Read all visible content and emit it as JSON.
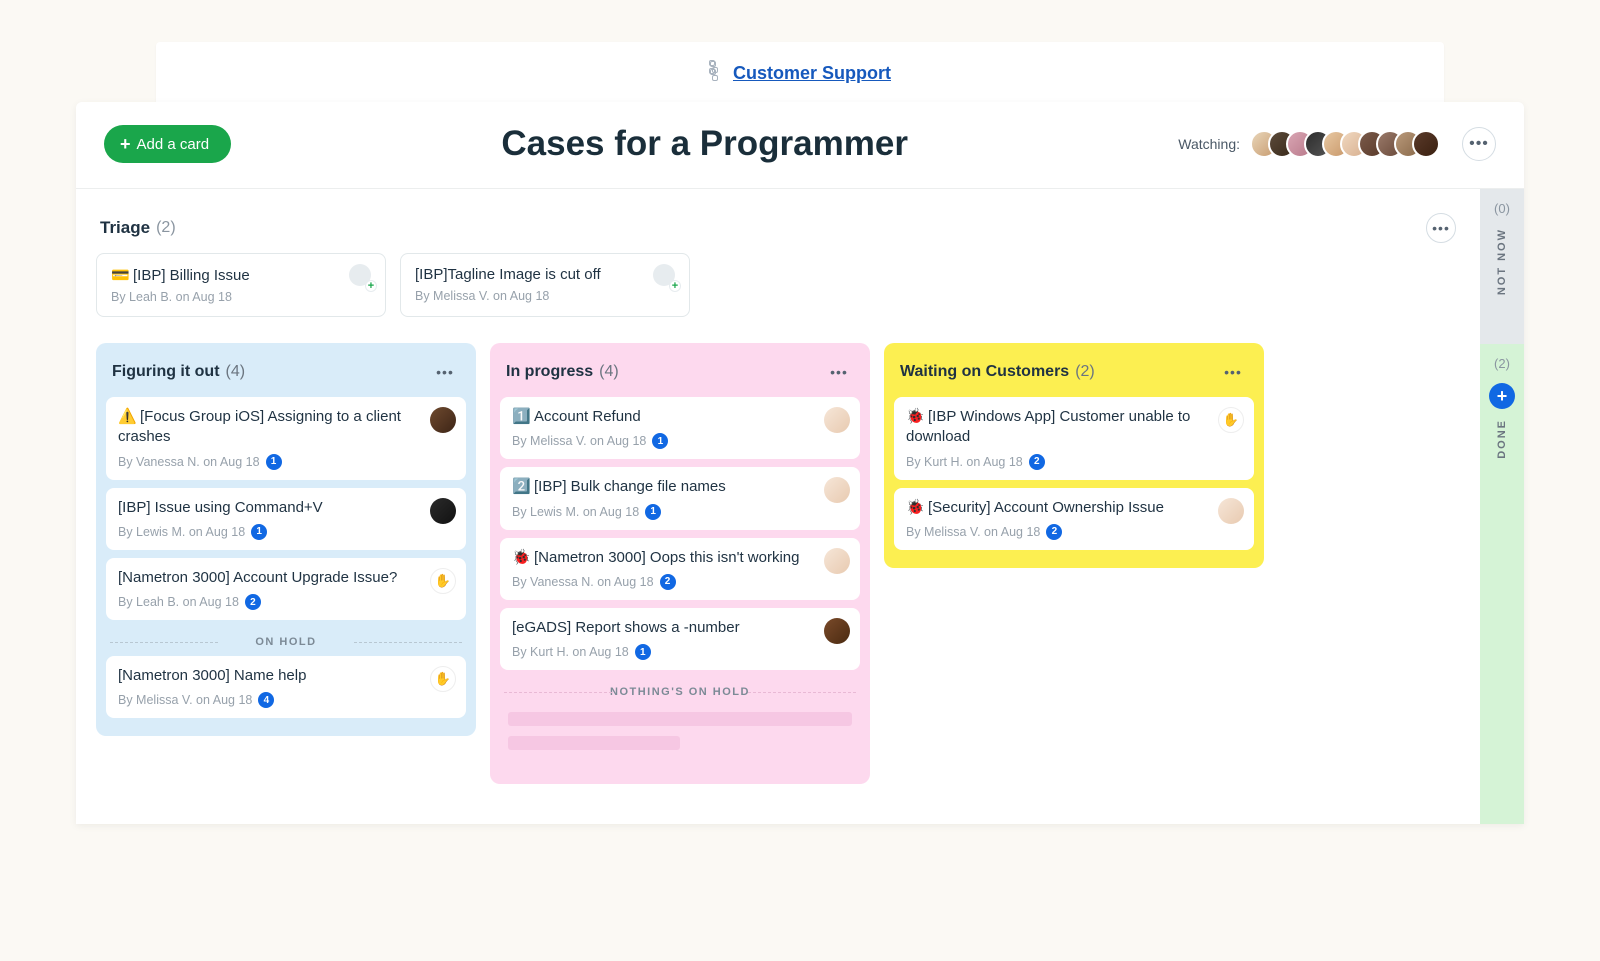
{
  "breadcrumb": {
    "label": "Customer Support"
  },
  "header": {
    "add_card_label": "Add a card",
    "title": "Cases for a Programmer",
    "watching_label": "Watching:"
  },
  "triage": {
    "title": "Triage",
    "count": "(2)",
    "cards": [
      {
        "icon": "💳",
        "title": "[IBP] Billing Issue",
        "by": "By Leah B. on Aug 18"
      },
      {
        "icon": "",
        "title": "[IBP]Tagline Image is cut off",
        "by": "By Melissa V. on Aug 18"
      }
    ]
  },
  "rails": {
    "not_now": {
      "count": "(0)",
      "label": "NOT NOW"
    },
    "done": {
      "count": "(2)",
      "label": "DONE"
    }
  },
  "columns": [
    {
      "color": "blue",
      "title": "Figuring it out",
      "count": "(4)",
      "cards": [
        {
          "icon": "⚠️",
          "title": "[Focus Group iOS] Assigning to a client crashes",
          "by": "By Vanessa N. on Aug 18",
          "badge": "1",
          "avatar": "v"
        },
        {
          "icon": "",
          "title": "[IBP] Issue using Command+V",
          "by": "By Lewis M. on Aug 18",
          "badge": "1",
          "avatar": "l"
        },
        {
          "icon": "",
          "title": "[Nametron 3000] Account Upgrade Issue?",
          "by": "By Leah B. on Aug 18",
          "badge": "2",
          "avatar": "badgeimg"
        }
      ],
      "on_hold_label": "ON HOLD",
      "hold_cards": [
        {
          "icon": "",
          "title": "[Nametron 3000] Name help",
          "by": "By Melissa V. on Aug 18",
          "badge": "4",
          "avatar": "badgeimg"
        }
      ]
    },
    {
      "color": "pink",
      "title": "In progress",
      "count": "(4)",
      "cards": [
        {
          "icon": "1️⃣",
          "title": "Account Refund",
          "by": "By Melissa V. on Aug 18",
          "badge": "1",
          "avatar": "p"
        },
        {
          "icon": "2️⃣",
          "title": "[IBP] Bulk change file names",
          "by": "By Lewis M. on Aug 18",
          "badge": "1",
          "avatar": "p"
        },
        {
          "icon": "🐞",
          "title": "[Nametron 3000] Oops this isn't working",
          "by": "By Vanessa N. on Aug 18",
          "badge": "2",
          "avatar": "p"
        },
        {
          "icon": "",
          "title": "[eGADS] Report shows a -number",
          "by": "By Kurt H. on Aug 18",
          "badge": "1",
          "avatar": "k"
        }
      ],
      "on_hold_label": "NOTHING'S ON HOLD",
      "hold_cards": []
    },
    {
      "color": "yellow",
      "title": "Waiting on Customers",
      "count": "(2)",
      "cards": [
        {
          "icon": "🐞",
          "title": "[IBP Windows App] Customer unable to download",
          "by": "By Kurt H. on Aug 18",
          "badge": "2",
          "avatar": "badgeimg"
        },
        {
          "icon": "🐞",
          "title": "[Security] Account Ownership Issue",
          "by": "By Melissa V. on Aug 18",
          "badge": "2",
          "avatar": "p"
        }
      ],
      "on_hold_label": "",
      "hold_cards": []
    }
  ]
}
